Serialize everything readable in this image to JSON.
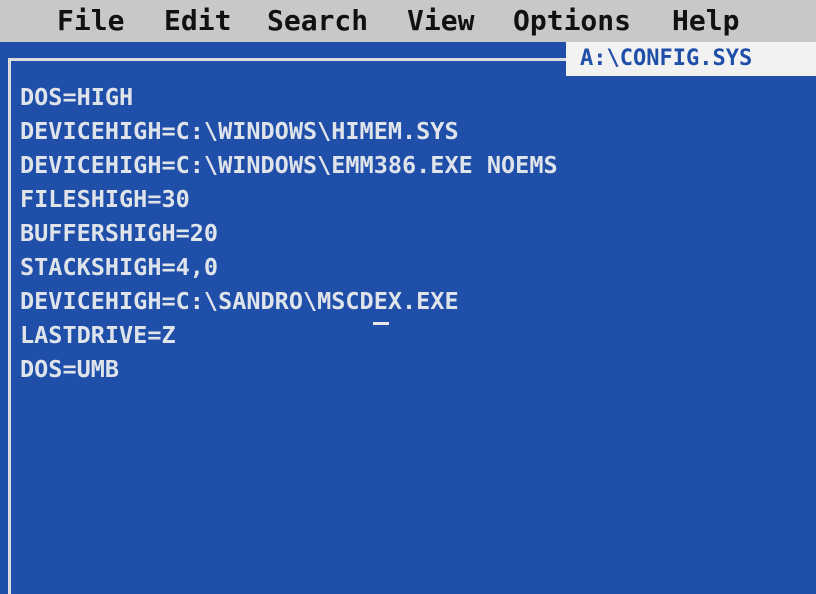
{
  "menu": {
    "file": "File",
    "edit": "Edit",
    "search": "Search",
    "view": "View",
    "options": "Options",
    "help": "Help"
  },
  "document": {
    "title": "A:\\CONFIG.SYS",
    "lines": [
      "DOS=HIGH",
      "DEVICEHIGH=C:\\WINDOWS\\HIMEM.SYS",
      "DEVICEHIGH=C:\\WINDOWS\\EMM386.EXE NOEMS",
      "FILESHIGH=30",
      "BUFFERSHIGH=20",
      "STACKSHIGH=4,0",
      "DEVICEHIGH=C:\\SANDRO\\MSCDEX.EXE",
      "LASTDRIVE=Z",
      "DOS=UMB"
    ]
  },
  "colors": {
    "background": "#1f4fa8",
    "menubar": "#c8c8c8",
    "text": "#dfe3ea"
  }
}
